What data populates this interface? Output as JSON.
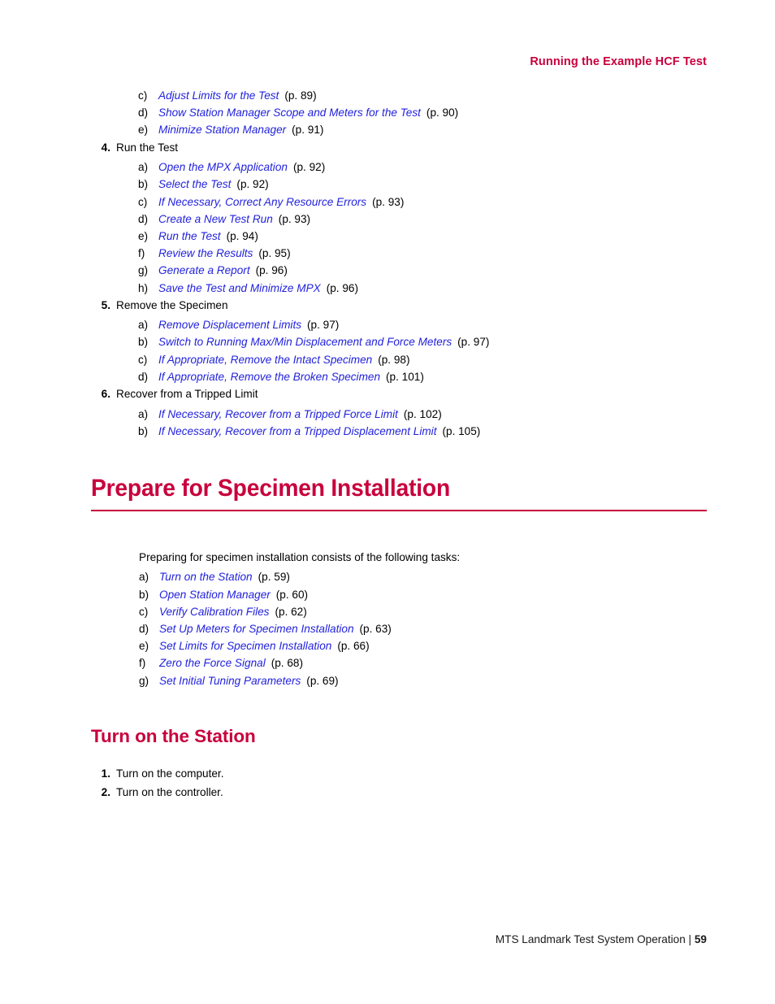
{
  "header": {
    "running_title": "Running the Example HCF Test"
  },
  "top_list": {
    "items": [
      {
        "marker": "c)",
        "title": "Adjust Limits for the Test",
        "page": "(p. 89)"
      },
      {
        "marker": "d)",
        "title": "Show Station Manager Scope and Meters for the Test",
        "page": "(p. 90)"
      },
      {
        "marker": "e)",
        "title": "Minimize Station Manager",
        "page": "(p. 91)"
      }
    ]
  },
  "steps": [
    {
      "marker": "4.",
      "label": "Run the Test",
      "subitems": [
        {
          "marker": "a)",
          "title": "Open the MPX Application",
          "page": "(p. 92)"
        },
        {
          "marker": "b)",
          "title": "Select the Test",
          "page": "(p. 92)"
        },
        {
          "marker": "c)",
          "title": "If Necessary, Correct Any Resource Errors",
          "page": "(p. 93)"
        },
        {
          "marker": "d)",
          "title": "Create a New Test Run",
          "page": "(p. 93)"
        },
        {
          "marker": "e)",
          "title": "Run the Test",
          "page": "(p. 94)"
        },
        {
          "marker": "f)",
          "title": "Review the Results",
          "page": "(p. 95)"
        },
        {
          "marker": "g)",
          "title": "Generate a Report",
          "page": "(p. 96)"
        },
        {
          "marker": "h)",
          "title": "Save the Test and Minimize MPX",
          "page": "(p. 96)"
        }
      ]
    },
    {
      "marker": "5.",
      "label": "Remove the Specimen",
      "subitems": [
        {
          "marker": "a)",
          "title": "Remove Displacement Limits",
          "page": "(p. 97)"
        },
        {
          "marker": "b)",
          "title": "Switch to Running Max/Min Displacement and Force Meters",
          "page": "(p. 97)"
        },
        {
          "marker": "c)",
          "title": "If Appropriate, Remove the Intact Specimen",
          "page": "(p. 98)"
        },
        {
          "marker": "d)",
          "title": "If Appropriate, Remove the Broken Specimen",
          "page": "(p. 101)"
        }
      ]
    },
    {
      "marker": "6.",
      "label": "Recover from a Tripped Limit",
      "subitems": [
        {
          "marker": "a)",
          "title": "If Necessary, Recover from a Tripped Force Limit",
          "page": "(p. 102)"
        },
        {
          "marker": "b)",
          "title": "If Necessary, Recover from a Tripped Displacement Limit",
          "page": "(p. 105)"
        }
      ]
    }
  ],
  "chapter": {
    "heading": "Prepare for Specimen Installation"
  },
  "intro": {
    "paragraph": "Preparing for specimen installation consists of the following tasks:",
    "items": [
      {
        "marker": "a)",
        "title": "Turn on the Station",
        "page": "(p. 59)"
      },
      {
        "marker": "b)",
        "title": "Open Station Manager",
        "page": "(p. 60)"
      },
      {
        "marker": "c)",
        "title": "Verify Calibration Files",
        "page": "(p. 62)"
      },
      {
        "marker": "d)",
        "title": "Set Up Meters for Specimen Installation",
        "page": "(p. 63)"
      },
      {
        "marker": "e)",
        "title": "Set Limits for Specimen Installation",
        "page": "(p. 66)"
      },
      {
        "marker": "f)",
        "title": "Zero the Force Signal",
        "page": "(p. 68)"
      },
      {
        "marker": "g)",
        "title": "Set Initial Tuning Parameters",
        "page": "(p. 69)"
      }
    ]
  },
  "section": {
    "heading": "Turn on the Station",
    "steps": [
      {
        "marker": "1.",
        "label": "Turn on the computer."
      },
      {
        "marker": "2.",
        "label": "Turn on the controller."
      }
    ]
  },
  "footer": {
    "document_title": "MTS Landmark Test System Operation |",
    "page_number": "59"
  },
  "colors": {
    "accent": "#C8003C",
    "link": "#2222DD",
    "text": "#000000"
  }
}
